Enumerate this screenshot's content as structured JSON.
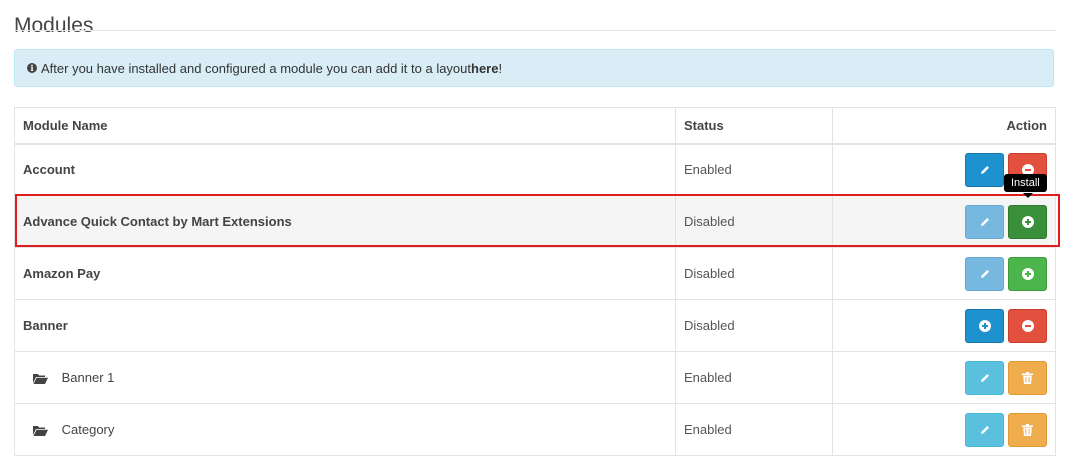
{
  "page": {
    "title": "Modules"
  },
  "alert": {
    "text_before": " After you have installed and configured a module you can add it to a layout ",
    "link_text": "here",
    "text_after": "!"
  },
  "table": {
    "headers": {
      "name": "Module Name",
      "status": "Status",
      "action": "Action"
    },
    "rows": [
      {
        "name": "Account",
        "status": "Enabled"
      },
      {
        "name": "Advance Quick Contact by Mart Extensions",
        "status": "Disabled"
      },
      {
        "name": "Amazon Pay",
        "status": "Disabled"
      },
      {
        "name": "Banner",
        "status": "Disabled"
      },
      {
        "name": "Banner 1",
        "status": "Enabled"
      },
      {
        "name": "Category",
        "status": "Enabled"
      }
    ]
  },
  "tooltip": {
    "text": "Install"
  },
  "colors": {
    "primary": "#1e91cf",
    "danger": "#e3503e",
    "success": "#4cb64c",
    "info": "#5bc0de",
    "warning": "#f0ad4e",
    "highlight_frame": "#e01e1e"
  }
}
